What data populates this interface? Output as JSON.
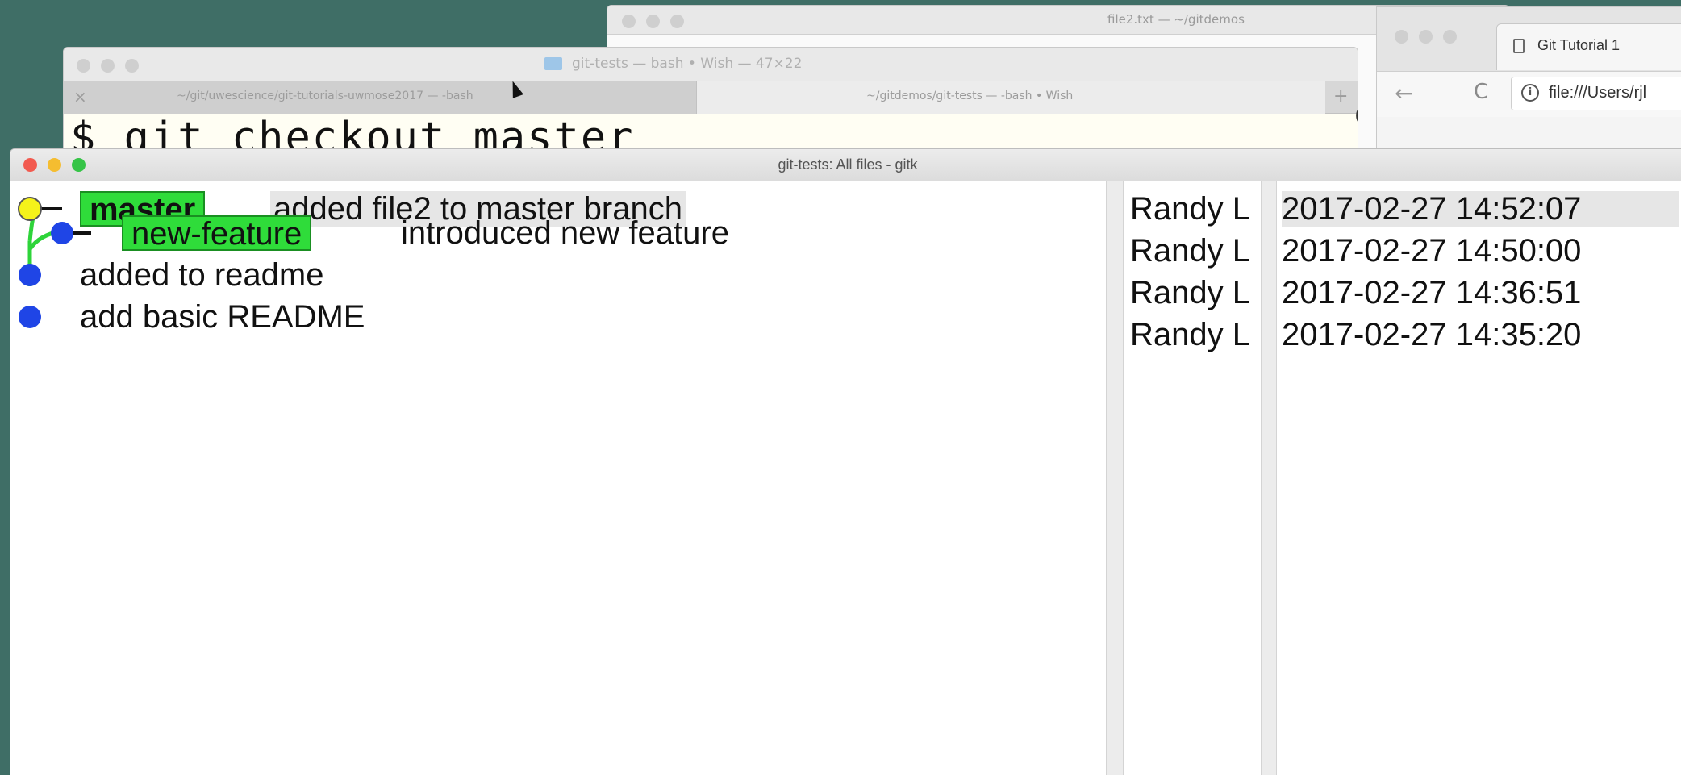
{
  "textedit": {
    "title": "file2.txt — ~/gitdemos"
  },
  "browser": {
    "tab_title": "Git Tutorial 1",
    "url": "file:///Users/rjl",
    "back_glyph": "←",
    "reload_glyph": "C",
    "info_glyph": "i"
  },
  "terminal": {
    "title": "git-tests — bash • Wish — 47×22",
    "tabs": [
      {
        "label": "~/git/uwescience/git-tutorials-uwmose2017 — -bash",
        "close": "×"
      },
      {
        "label": "~/gitdemos/git-tests — -bash • Wish"
      }
    ],
    "new_tab": "+",
    "command": "$ git checkout master",
    "right_fragment": "d"
  },
  "gitk": {
    "title": "git-tests: All files - gitk",
    "commits": [
      {
        "branch": "master",
        "message": "added file2 to master branch",
        "author": "Randy L",
        "date": "2017-02-27 14:52:07",
        "node_color": "#f5f21a",
        "selected": true
      },
      {
        "branch": "new-feature",
        "message": "introduced new feature",
        "author": "Randy L",
        "date": "2017-02-27 14:50:00",
        "node_color": "#1f45e6"
      },
      {
        "branch": "",
        "message": "added to readme",
        "author": "Randy L",
        "date": "2017-02-27 14:36:51",
        "node_color": "#1f45e6"
      },
      {
        "branch": "",
        "message": "add basic README",
        "author": "Randy L",
        "date": "2017-02-27 14:35:20",
        "node_color": "#1f45e6"
      }
    ],
    "colors": {
      "branch_label": "#2fdc3a",
      "graph_line": "#2ed43a",
      "head_node": "#f5f21a",
      "commit_node": "#1f45e6"
    }
  }
}
